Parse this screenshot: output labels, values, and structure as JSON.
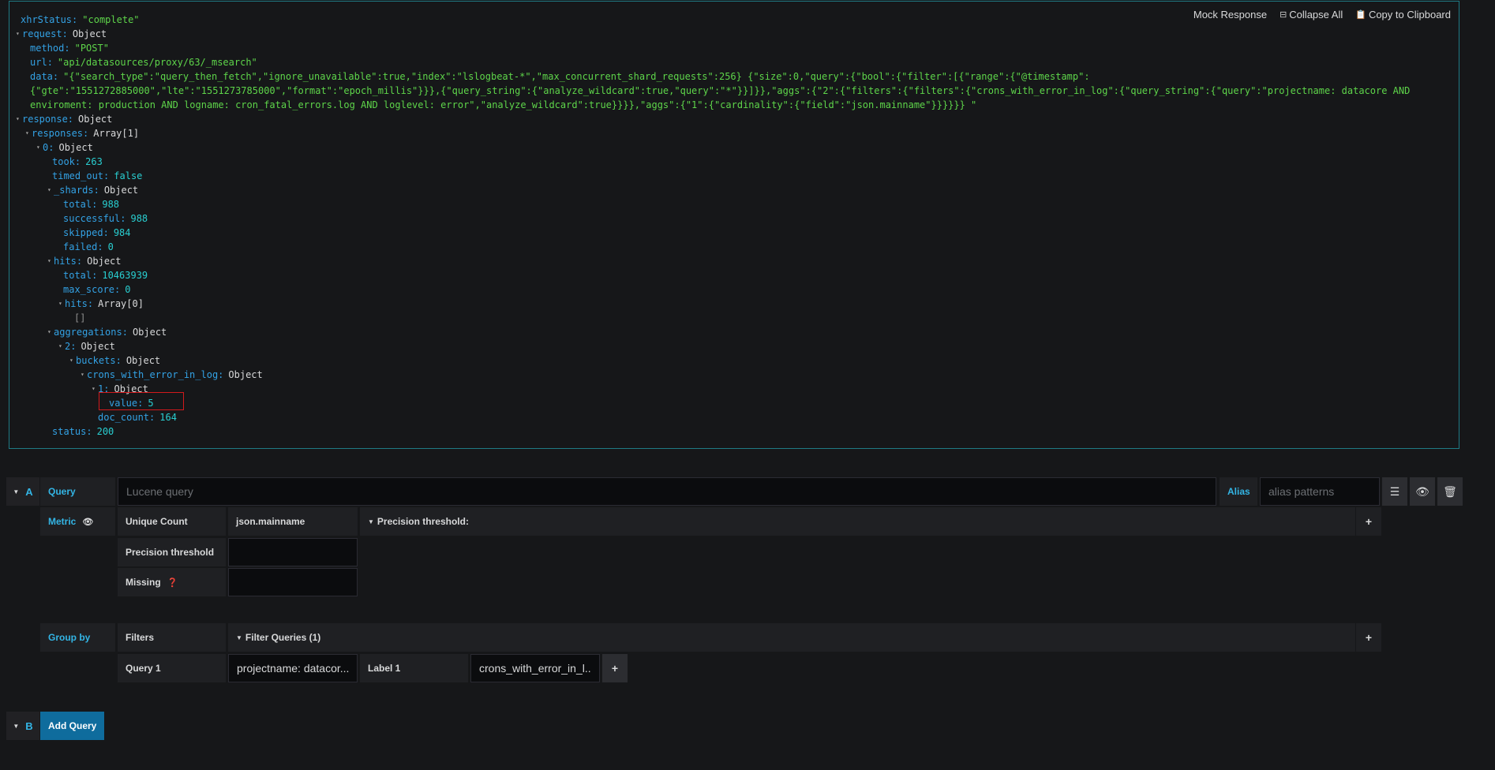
{
  "toolbar": {
    "mock_response": "Mock Response",
    "collapse_all": "Collapse All",
    "copy_clipboard": "Copy to Clipboard"
  },
  "tree": {
    "xhr_status_key": "xhrStatus",
    "xhr_status_val": "\"complete\"",
    "request_key": "request",
    "object": "Object",
    "method_key": "method",
    "method_val": "\"POST\"",
    "url_key": "url",
    "url_val": "\"api/datasources/proxy/63/_msearch\"",
    "data_key": "data",
    "data_line1": "\"{\"search_type\":\"query_then_fetch\",\"ignore_unavailable\":true,\"index\":\"lslogbeat-*\",\"max_concurrent_shard_requests\":256} {\"size\":0,\"query\":{\"bool\":{\"filter\":[{\"range\":{\"@timestamp\":",
    "data_line2": "{\"gte\":\"1551272885000\",\"lte\":\"1551273785000\",\"format\":\"epoch_millis\"}}},{\"query_string\":{\"analyze_wildcard\":true,\"query\":\"*\"}}]}},\"aggs\":{\"2\":{\"filters\":{\"filters\":{\"crons_with_error_in_log\":{\"query_string\":{\"query\":\"projectname: datacore AND",
    "data_line3": "enviroment: production AND logname: cron_fatal_errors.log AND loglevel: error\",\"analyze_wildcard\":true}}}},\"aggs\":{\"1\":{\"cardinality\":{\"field\":\"json.mainname\"}}}}}} \"",
    "response_key": "response",
    "responses_key": "responses",
    "array1": "Array[1]",
    "idx0_key": "0",
    "took_key": "took",
    "took_val": "263",
    "timed_out_key": "timed_out",
    "timed_out_val": "false",
    "shards_key": "_shards",
    "total_key": "total",
    "shards_total_val": "988",
    "successful_key": "successful",
    "successful_val": "988",
    "skipped_key": "skipped",
    "skipped_val": "984",
    "failed_key": "failed",
    "failed_val": "0",
    "hits_key": "hits",
    "hits_total_val": "10463939",
    "max_score_key": "max_score",
    "max_score_val": "0",
    "array0": "Array[0]",
    "empty_arr": "[]",
    "aggregations_key": "aggregations",
    "agg2_key": "2",
    "buckets_key": "buckets",
    "crons_key": "crons_with_error_in_log",
    "agg1_key": "1",
    "value_key": "value",
    "value_val": "5",
    "doc_count_key": "doc_count",
    "doc_count_val": "164",
    "status_key": "status",
    "status_val": "200"
  },
  "query_a": {
    "letter": "A",
    "query_label": "Query",
    "query_placeholder": "Lucene query",
    "alias_label": "Alias",
    "alias_placeholder": "alias patterns",
    "metric_label": "Metric",
    "metric_type": "Unique Count",
    "metric_field": "json.mainname",
    "precision_toggle": "Precision threshold:",
    "precision_label": "Precision threshold",
    "missing_label": "Missing",
    "group_by_label": "Group by",
    "group_by_type": "Filters",
    "filter_queries": "Filter Queries (1)",
    "query1_label": "Query 1",
    "query1_value": "projectname: datacor...",
    "label1_label": "Label 1",
    "label1_value": "crons_with_error_in_l..."
  },
  "query_b": {
    "letter": "B",
    "add_query": "Add Query"
  }
}
